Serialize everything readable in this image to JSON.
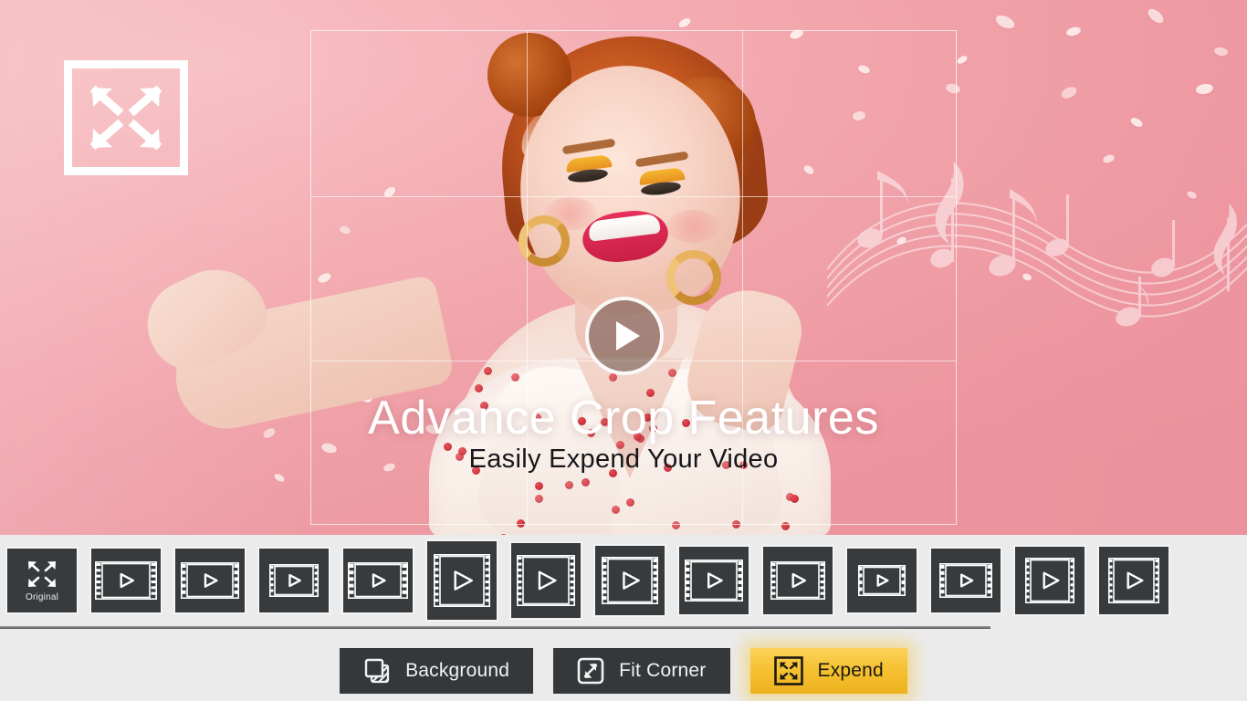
{
  "preview": {
    "expand_badge_icon": "expand-arrows-icon",
    "play_button_icon": "play-icon",
    "title": "Advance Crop Features",
    "subtitle": "Easily Expend Your Video",
    "crop_grid": {
      "columns": 3,
      "rows": 3,
      "visible": true
    },
    "decoration_icon": "music-notes-icon",
    "background_color": "#f2a3aa",
    "title_color": "#ffffff",
    "subtitle_color": "#16161a"
  },
  "thumbnail_strip": {
    "items": [
      {
        "name": "thumb-original",
        "label": "Original",
        "icon": "expand-arrows-icon",
        "selected": false,
        "w": 76,
        "h": 70,
        "fw": 0,
        "fh": 0
      },
      {
        "name": "thumb-ratio-1",
        "label": "",
        "icon": "filmstrip-icon",
        "selected": false,
        "w": 76,
        "h": 70,
        "fw": 68,
        "fh": 42
      },
      {
        "name": "thumb-ratio-2",
        "label": "",
        "icon": "filmstrip-icon",
        "selected": false,
        "w": 76,
        "h": 70,
        "fw": 64,
        "fh": 40
      },
      {
        "name": "thumb-ratio-3",
        "label": "",
        "icon": "filmstrip-icon",
        "selected": false,
        "w": 76,
        "h": 70,
        "fw": 54,
        "fh": 36
      },
      {
        "name": "thumb-ratio-4",
        "label": "",
        "icon": "filmstrip-icon",
        "selected": false,
        "w": 76,
        "h": 70,
        "fw": 66,
        "fh": 40
      },
      {
        "name": "thumb-ratio-5",
        "label": "",
        "icon": "filmstrip-icon",
        "selected": true,
        "w": 76,
        "h": 86,
        "fw": 62,
        "fh": 58
      },
      {
        "name": "thumb-ratio-6",
        "label": "",
        "icon": "filmstrip-icon",
        "selected": true,
        "w": 76,
        "h": 82,
        "fw": 64,
        "fh": 56
      },
      {
        "name": "thumb-ratio-7",
        "label": "",
        "icon": "filmstrip-icon",
        "selected": false,
        "w": 76,
        "h": 76,
        "fw": 62,
        "fh": 52
      },
      {
        "name": "thumb-ratio-8",
        "label": "",
        "icon": "filmstrip-icon",
        "selected": false,
        "w": 76,
        "h": 74,
        "fw": 64,
        "fh": 46
      },
      {
        "name": "thumb-ratio-9",
        "label": "",
        "icon": "filmstrip-icon",
        "selected": false,
        "w": 76,
        "h": 74,
        "fw": 60,
        "fh": 42
      },
      {
        "name": "thumb-ratio-10",
        "label": "",
        "icon": "filmstrip-icon",
        "selected": false,
        "w": 76,
        "h": 70,
        "fw": 52,
        "fh": 34
      },
      {
        "name": "thumb-ratio-11",
        "label": "",
        "icon": "filmstrip-icon",
        "selected": false,
        "w": 76,
        "h": 70,
        "fw": 58,
        "fh": 38
      },
      {
        "name": "thumb-ratio-12",
        "label": "",
        "icon": "filmstrip-icon",
        "selected": false,
        "w": 76,
        "h": 74,
        "fw": 54,
        "fh": 50
      },
      {
        "name": "thumb-ratio-13",
        "label": "",
        "icon": "filmstrip-icon",
        "selected": false,
        "w": 76,
        "h": 74,
        "fw": 56,
        "fh": 50
      }
    ]
  },
  "bottom_bar": {
    "buttons": [
      {
        "name": "background-button",
        "label": "Background",
        "icon": "layers-icon",
        "style": "dark"
      },
      {
        "name": "fit-corner-button",
        "label": "Fit Corner",
        "icon": "fit-corner-icon",
        "style": "dark"
      },
      {
        "name": "expend-button",
        "label": "Expend",
        "icon": "expand-arrows-icon",
        "style": "primary"
      }
    ],
    "primary_color": "#f5c233",
    "dark_color": "#35383a"
  }
}
